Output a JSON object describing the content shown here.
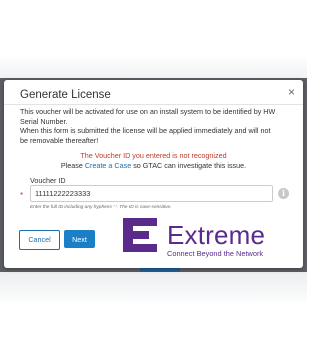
{
  "dialog": {
    "title": "Generate License",
    "description_lines": [
      "This voucher will be activated for use on an install system to be identified by HW",
      "Serial Number.",
      "When this form is submitted the license will be applied immediately and will not",
      "be removable thereafter!"
    ],
    "error": {
      "message": "The Voucher ID you entered is not recognized",
      "help_prefix": "Please",
      "help_link": "Create a Case",
      "help_suffix": "so GTAC can investigate this issue."
    },
    "voucher": {
      "label": "Voucher ID",
      "required_mark": "*",
      "value": "11111222223333",
      "hint": "Enter the full ID including any hyphens '-'. The ID is case-sensitive."
    },
    "buttons": {
      "cancel": "Cancel",
      "next": "Next"
    },
    "close_glyph": "×"
  },
  "logo": {
    "wordmark": "Extreme",
    "tagline": "Connect Beyond the Network",
    "color": "#5b2b8c"
  },
  "colors": {
    "primary": "#1a7fc4",
    "error": "#c0392b",
    "link": "#1a6fb4"
  }
}
